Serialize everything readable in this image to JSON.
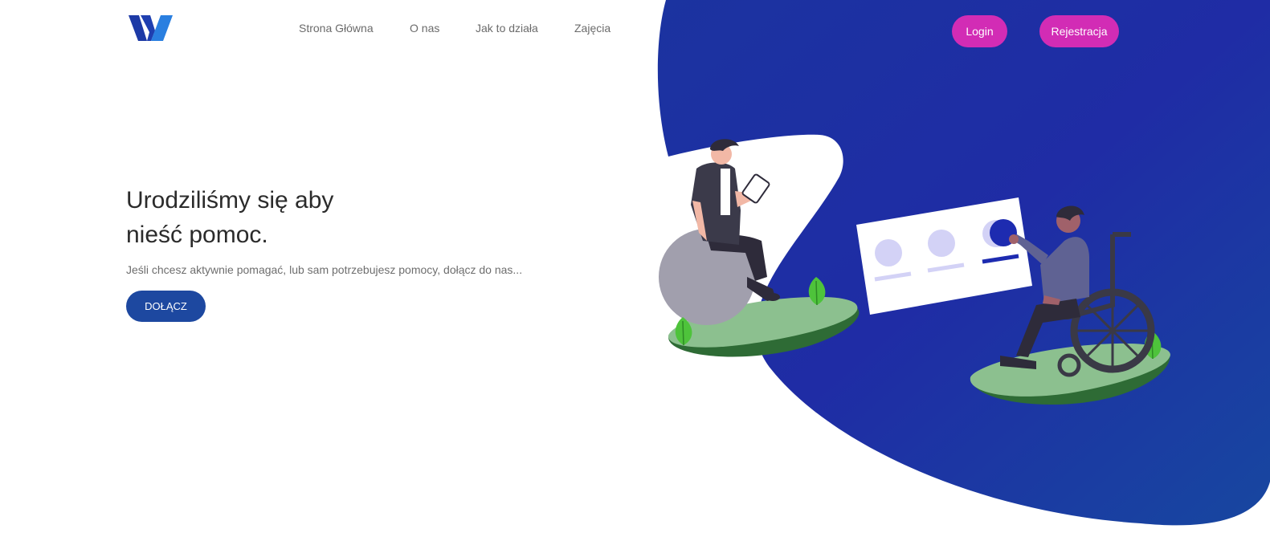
{
  "header": {
    "logo_icon": "brand-w-logo",
    "nav": [
      {
        "label": "Strona Główna"
      },
      {
        "label": "O nas"
      },
      {
        "label": "Jak to działa"
      },
      {
        "label": "Zajęcia"
      }
    ],
    "login_label": "Login",
    "register_label": "Rejestracja"
  },
  "hero": {
    "title_line1": "Urodziliśmy się aby",
    "title_line2": "nieść pomoc.",
    "subtitle": "Jeśli chcesz aktywnie pomagać, lub sam potrzebujesz pomocy, dołącz do nas...",
    "cta_label": "DOŁĄCZ"
  },
  "illustration": {
    "left_figure": "person-with-tablet-on-rock",
    "right_figure": "person-in-wheelchair-with-board"
  },
  "colors": {
    "brand_blue": "#1d3aa6",
    "accent_pink": "#d22cb5",
    "cta_blue": "#1d48a0",
    "platform_green": "#8cc08f",
    "platform_dark_green": "#2e6b35",
    "leaf_green": "#4ec33b",
    "placeholder_purple": "#d3d2f6"
  }
}
